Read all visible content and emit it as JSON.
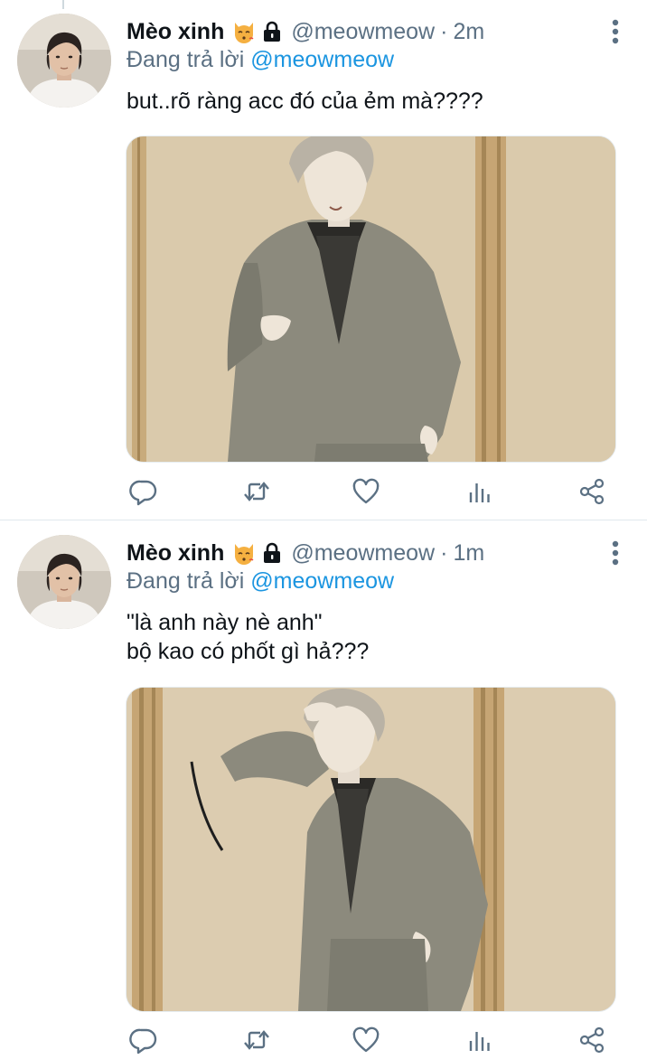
{
  "colors": {
    "text": "#0f1419",
    "secondary": "#5b7083",
    "link": "#1b95e0",
    "divider": "#e1e8ed"
  },
  "tweets": [
    {
      "display_name": "Mèo xinh",
      "handle": "@meowmeow",
      "separator": "·",
      "time": "2m",
      "reply_prefix": "Đang trả lời",
      "reply_to": "@meowmeow",
      "text_lines": [
        "but..rõ ràng acc đó của ẻm mà????"
      ],
      "icons": [
        "kissing-cat-emoji",
        "lock-icon",
        "more-icon"
      ]
    },
    {
      "display_name": "Mèo xinh",
      "handle": "@meowmeow",
      "separator": "·",
      "time": "1m",
      "reply_prefix": "Đang trả lời",
      "reply_to": "@meowmeow",
      "text_lines": [
        "\"là anh này nè anh\"",
        "bộ kao có phốt gì hả???"
      ],
      "icons": [
        "kissing-cat-emoji",
        "lock-icon",
        "more-icon"
      ]
    }
  ],
  "action_bar": [
    "reply-icon",
    "retweet-icon",
    "like-icon",
    "analytics-icon",
    "share-icon"
  ]
}
